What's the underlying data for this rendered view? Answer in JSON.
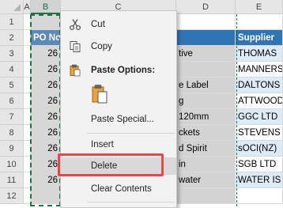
{
  "columns": [
    "A",
    "B",
    "C",
    "D",
    "E"
  ],
  "rows": [
    "1",
    "2",
    "3",
    "4",
    "5",
    "6",
    "7",
    "8",
    "9",
    "10",
    "11",
    "12"
  ],
  "header_row": {
    "po": "PO No",
    "supplier": "Supplier"
  },
  "col_b_values": [
    "26",
    "26",
    "26",
    "26",
    "26",
    "26",
    "26",
    "26",
    "26"
  ],
  "col_d_values": [
    "tive",
    "",
    "e Label",
    "g",
    "120mm",
    "ckets",
    "d Spirit",
    "in",
    "water"
  ],
  "suppliers": [
    "THOMAS",
    "MANNERS",
    "DALTONS",
    "ATTWOOD",
    "GGC LTD",
    "STEVENS",
    "sOCI(NZ)",
    "SGB LTD",
    "WATER IS"
  ],
  "menu": {
    "cut": "Cut",
    "copy": "Copy",
    "paste_options": "Paste Options:",
    "paste_special": "Paste Special...",
    "insert": "Insert",
    "delete": "Delete",
    "clear_contents": "Clear Contents"
  },
  "colors": {
    "header_blue": "#2f75b5",
    "selection_green": "#217346",
    "highlight_red": "#e8474a"
  }
}
